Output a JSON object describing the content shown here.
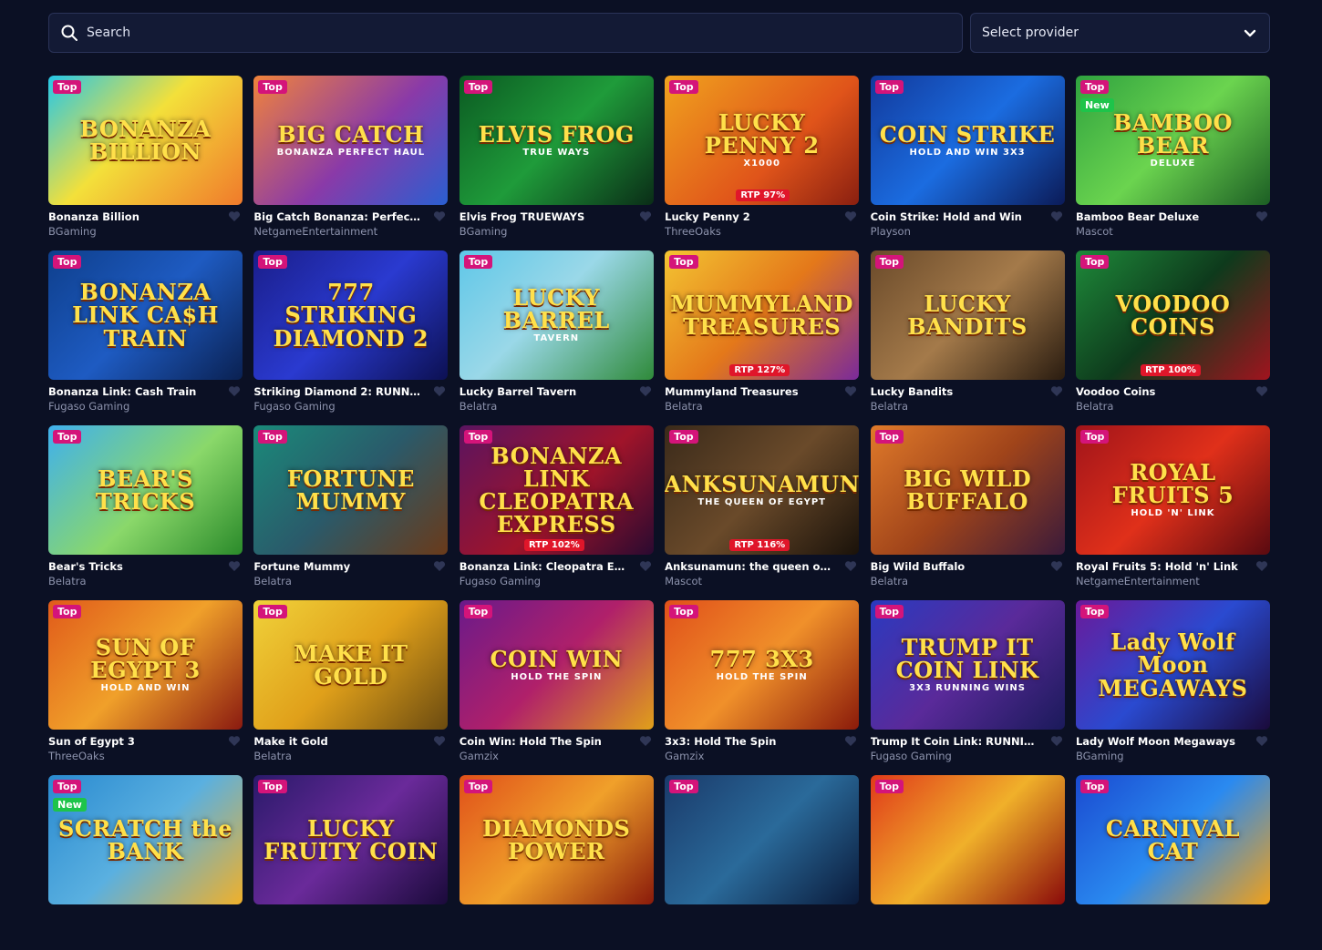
{
  "search": {
    "placeholder": "Search"
  },
  "provider_select": {
    "selected": "Select provider"
  },
  "badges": {
    "top": "Top",
    "new": "New"
  },
  "games": [
    {
      "title": "Bonanza Billion",
      "provider": "BGaming",
      "badges": [
        "Top"
      ],
      "art": "BONANZA BILLION",
      "bg": "linear-gradient(135deg,#25c7e8,#f3e03a 45%,#f07a2b)",
      "rtp": ""
    },
    {
      "title": "Big Catch Bonanza: Perfect H...",
      "provider": "NetgameEntertainment",
      "badges": [
        "Top"
      ],
      "art": "BIG CATCH",
      "art_sub": "BONANZA PERFECT HAUL",
      "bg": "linear-gradient(135deg,#f1833b,#8a3aa8 55%,#2a5fd1)",
      "rtp": ""
    },
    {
      "title": "Elvis Frog TRUEWAYS",
      "provider": "BGaming",
      "badges": [
        "Top"
      ],
      "art": "ELVIS FROG",
      "art_sub": "TRUE WAYS",
      "bg": "linear-gradient(135deg,#0b5a22,#1f9b3a 50%,#0a2d17)",
      "rtp": ""
    },
    {
      "title": "Lucky Penny 2",
      "provider": "ThreeOaks",
      "badges": [
        "Top"
      ],
      "art": "LUCKY PENNY 2",
      "art_sub": "X1000",
      "bg": "linear-gradient(135deg,#f0a21e,#e0541a 60%,#8a1f10)",
      "rtp": "RTP 97%"
    },
    {
      "title": "Coin Strike: Hold and Win",
      "provider": "Playson",
      "badges": [
        "Top"
      ],
      "art": "COIN STRIKE",
      "art_sub": "HOLD AND WIN 3X3",
      "bg": "linear-gradient(135deg,#123a9c,#1b6ce0 50%,#0b1b58)",
      "rtp": ""
    },
    {
      "title": "Bamboo Bear Deluxe",
      "provider": "Mascot",
      "badges": [
        "Top",
        "New"
      ],
      "art": "BAMBOO BEAR",
      "art_sub": "DELUXE",
      "bg": "linear-gradient(135deg,#2fa23f,#6bd44f 50%,#1c5e24)",
      "rtp": ""
    },
    {
      "title": "Bonanza Link: Cash Train",
      "provider": "Fugaso Gaming",
      "badges": [
        "Top"
      ],
      "art": "BONANZA LINK CA$H TRAIN",
      "bg": "linear-gradient(135deg,#0e3f8c,#1e5bc2 50%,#0a2152)",
      "rtp": ""
    },
    {
      "title": "Striking Diamond 2: RUNNIN...",
      "provider": "Fugaso Gaming",
      "badges": [
        "Top"
      ],
      "art": "777 STRIKING DIAMOND 2",
      "bg": "linear-gradient(135deg,#1a1e8a,#2a3ad0 50%,#0c1052)",
      "rtp": ""
    },
    {
      "title": "Lucky Barrel Tavern",
      "provider": "Belatra",
      "badges": [
        "Top"
      ],
      "art": "LUCKY BARREL",
      "art_sub": "TAVERN",
      "bg": "linear-gradient(135deg,#5fc7e8,#9ad8e8 45%,#2f8a3a)",
      "rtp": ""
    },
    {
      "title": "Mummyland Treasures",
      "provider": "Belatra",
      "badges": [
        "Top"
      ],
      "art": "MUMMYLAND TREASURES",
      "bg": "linear-gradient(135deg,#f3c432,#e4781a 50%,#7a2a9a)",
      "rtp": "RTP 127%"
    },
    {
      "title": "Lucky Bandits",
      "provider": "Belatra",
      "badges": [
        "Top"
      ],
      "art": "LUCKY BANDITS",
      "bg": "linear-gradient(135deg,#6a4a2a,#a47a4a 50%,#2a1c10)",
      "rtp": ""
    },
    {
      "title": "Voodoo Coins",
      "provider": "Belatra",
      "badges": [
        "Top"
      ],
      "art": "VOODOO COINS",
      "bg": "linear-gradient(135deg,#1e8a3a,#0e3a1c 50%,#a0141e)",
      "rtp": "RTP 100%"
    },
    {
      "title": "Bear's Tricks",
      "provider": "Belatra",
      "badges": [
        "Top"
      ],
      "art": "BEAR'S TRICKS",
      "bg": "linear-gradient(135deg,#3fb0ee,#8ad86a 55%,#2a8a2a)",
      "rtp": ""
    },
    {
      "title": "Fortune Mummy",
      "provider": "Belatra",
      "badges": [
        "Top"
      ],
      "art": "FORTUNE MUMMY",
      "bg": "linear-gradient(135deg,#1a8a7a,#2a5a6a 50%,#6a3a1a)",
      "rtp": ""
    },
    {
      "title": "Bonanza Link: Cleopatra Exp...",
      "provider": "Fugaso Gaming",
      "badges": [
        "Top"
      ],
      "art": "BONANZA LINK CLEOPATRA EXPRESS",
      "bg": "linear-gradient(135deg,#5a1460,#a0142a 55%,#2a0a30)",
      "rtp": "RTP 102%"
    },
    {
      "title": "Anksunamun: the queen of E...",
      "provider": "Mascot",
      "badges": [
        "Top"
      ],
      "art": "ANKSUNAMUN",
      "art_sub": "THE QUEEN OF EGYPT",
      "bg": "linear-gradient(135deg,#3a2a1a,#6a4a2a 50%,#1a120a)",
      "rtp": "RTP 116%"
    },
    {
      "title": "Big Wild Buffalo",
      "provider": "Belatra",
      "badges": [
        "Top"
      ],
      "art": "BIG WILD BUFFALO",
      "bg": "linear-gradient(135deg,#e07a2a,#a0441a 50%,#3a1a3a)",
      "rtp": ""
    },
    {
      "title": "Royal Fruits 5: Hold 'n' Link",
      "provider": "NetgameEntertainment",
      "badges": [
        "Top"
      ],
      "art": "ROYAL FRUITS 5",
      "art_sub": "HOLD 'N' LINK",
      "bg": "linear-gradient(135deg,#a0141a,#e0301a 50%,#5a0a10)",
      "rtp": ""
    },
    {
      "title": "Sun of Egypt 3",
      "provider": "ThreeOaks",
      "badges": [
        "Top"
      ],
      "art": "SUN OF EGYPT 3",
      "art_sub": "HOLD AND WIN",
      "bg": "linear-gradient(135deg,#e05a1a,#f0a02a 50%,#8a1a10)",
      "rtp": ""
    },
    {
      "title": "Make it Gold",
      "provider": "Belatra",
      "badges": [
        "Top"
      ],
      "art": "MAKE IT GOLD",
      "bg": "linear-gradient(135deg,#f0d23a,#e0a01a 50%,#6a4a10)",
      "rtp": ""
    },
    {
      "title": "Coin Win: Hold The Spin",
      "provider": "Gamzix",
      "badges": [
        "Top"
      ],
      "art": "COIN WIN",
      "art_sub": "HOLD THE SPIN",
      "bg": "linear-gradient(135deg,#6a1a8a,#b0206a 50%,#e0a01a)",
      "rtp": ""
    },
    {
      "title": "3x3: Hold The Spin",
      "provider": "Gamzix",
      "badges": [
        "Top"
      ],
      "art": "777 3X3",
      "art_sub": "HOLD THE SPIN",
      "bg": "linear-gradient(135deg,#e0501a,#f0902a 50%,#8a1a0a)",
      "rtp": ""
    },
    {
      "title": "Trump It Coin Link: RUNNING...",
      "provider": "Fugaso Gaming",
      "badges": [
        "Top"
      ],
      "art": "TRUMP IT COIN LINK",
      "art_sub": "3X3 RUNNING WINS",
      "bg": "linear-gradient(135deg,#2a3ac0,#5a2a9a 50%,#1a1a5a)",
      "rtp": ""
    },
    {
      "title": "Lady Wolf Moon Megaways",
      "provider": "BGaming",
      "badges": [
        "Top"
      ],
      "art": "Lady Wolf Moon MEGAWAYS",
      "bg": "linear-gradient(135deg,#6a1a9a,#2a4ad0 50%,#1a0a3a)",
      "rtp": ""
    },
    {
      "title": "",
      "provider": "",
      "badges": [
        "Top",
        "New"
      ],
      "art": "SCRATCH the BANK",
      "bg": "linear-gradient(135deg,#2a8ad0,#5ab0e0 50%,#f0b02a)",
      "rtp": ""
    },
    {
      "title": "",
      "provider": "",
      "badges": [
        "Top"
      ],
      "art": "LUCKY FRUITY COIN",
      "bg": "linear-gradient(135deg,#2a1a6a,#6a2a9a 50%,#1a0a3a)",
      "rtp": ""
    },
    {
      "title": "",
      "provider": "",
      "badges": [
        "Top"
      ],
      "art": "DIAMONDS POWER",
      "bg": "linear-gradient(135deg,#e0501a,#f0a02a 50%,#8a1a0a)",
      "rtp": ""
    },
    {
      "title": "",
      "provider": "",
      "badges": [
        "Top"
      ],
      "art": "",
      "bg": "linear-gradient(135deg,#1a3a6a,#2a6a9a 50%,#0a1a3a)",
      "rtp": ""
    },
    {
      "title": "",
      "provider": "",
      "badges": [
        "Top"
      ],
      "art": "",
      "bg": "linear-gradient(135deg,#e03a1a,#f0b02a 50%,#8a0a0a)",
      "rtp": ""
    },
    {
      "title": "",
      "provider": "",
      "badges": [
        "Top"
      ],
      "art": "CARNIVAL CAT",
      "bg": "linear-gradient(135deg,#1a4ad0,#2a8af0 50%,#f0a01a)",
      "rtp": ""
    }
  ]
}
